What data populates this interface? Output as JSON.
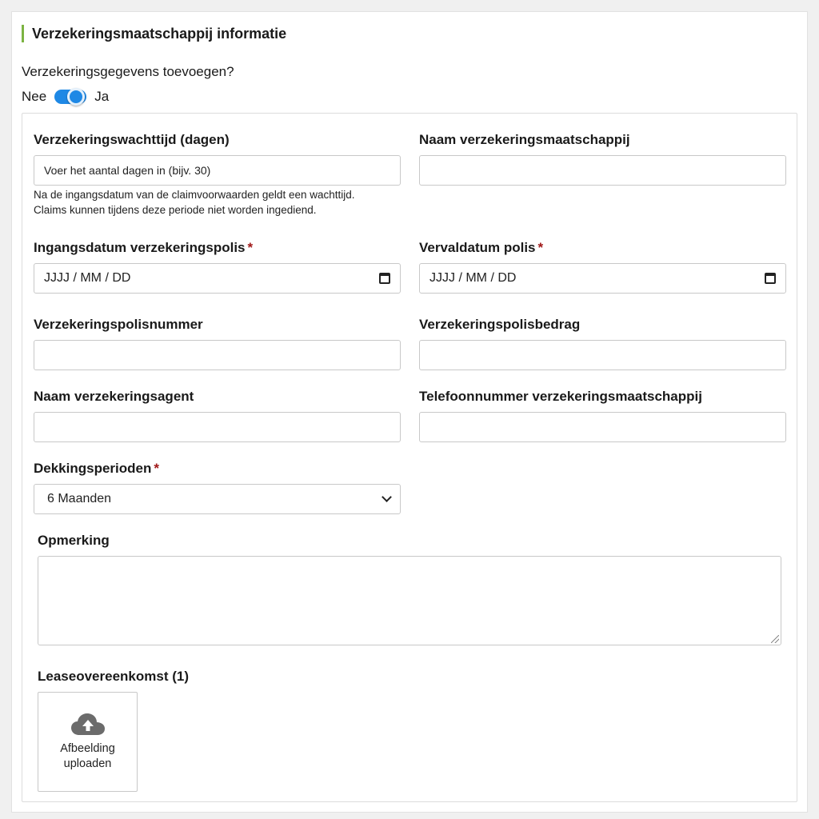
{
  "section_title": "Verzekeringsmaatschappij informatie",
  "toggle": {
    "question": "Verzekeringsgegevens toevoegen?",
    "off_label": "Nee",
    "on_label": "Ja",
    "state": "on",
    "color": "#1e88e5"
  },
  "fields": {
    "waiting_period": {
      "label": "Verzekeringswachttijd (dagen)",
      "placeholder": "Voer het aantal dagen in (bijv. 30)",
      "help_line1": "Na de ingangsdatum van de claimvoorwaarden geldt een wachttijd.",
      "help_line2": "Claims kunnen tijdens deze periode niet worden ingediend."
    },
    "company_name": {
      "label": "Naam verzekeringsmaatschappij",
      "value": ""
    },
    "start_date": {
      "label": "Ingangsdatum verzekeringspolis",
      "required": "*",
      "placeholder": "JJJJ / MM / DD"
    },
    "end_date": {
      "label": "Vervaldatum polis",
      "required": "*",
      "placeholder": "JJJJ / MM / DD"
    },
    "policy_number": {
      "label": "Verzekeringspolisnummer",
      "value": ""
    },
    "policy_amount": {
      "label": "Verzekeringspolisbedrag",
      "value": ""
    },
    "agent_name": {
      "label": "Naam verzekeringsagent",
      "value": ""
    },
    "company_phone": {
      "label": "Telefoonnummer verzekeringsmaatschappij",
      "value": ""
    },
    "coverage": {
      "label": "Dekkingsperioden",
      "required": "*",
      "selected": "6 Maanden"
    },
    "remark": {
      "label": "Opmerking",
      "value": ""
    },
    "lease": {
      "label": "Leaseovereenkomst (1)",
      "upload_line1": "Afbeelding",
      "upload_line2": "uploaden"
    }
  },
  "icons": {
    "calendar": "calendar-icon",
    "dropdown": "chevron-down-icon",
    "upload": "cloud-upload-icon"
  },
  "colors": {
    "accent_bar": "#7cb342",
    "required_mark": "#a01818",
    "toggle_blue": "#1e88e5"
  }
}
